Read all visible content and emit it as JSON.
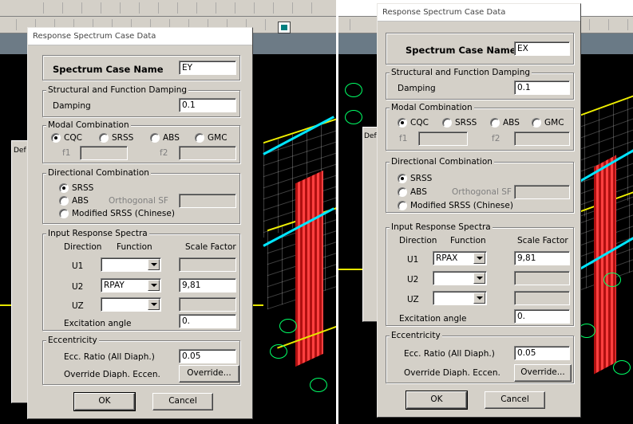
{
  "left": {
    "title": "Response Spectrum Case Data",
    "spectrum_case_name_label": "Spectrum Case Name",
    "spectrum_case_name": "EY",
    "damping_group_label": "Structural and Function Damping",
    "damping_label": "Damping",
    "damping_value": "0.1",
    "modal_group_label": "Modal Combination",
    "modal_options": [
      "CQC",
      "SRSS",
      "ABS",
      "GMC"
    ],
    "modal_selected": "CQC",
    "f1_label": "f1",
    "f2_label": "f2",
    "directional_group_label": "Directional Combination",
    "dir_srss": "SRSS",
    "dir_abs": "ABS",
    "orthogonal_sf_label": "Orthogonal SF",
    "dir_modified": "Modified SRSS (Chinese)",
    "dir_selected": "SRSS",
    "input_group_label": "Input Response Spectra",
    "col_direction": "Direction",
    "col_function": "Function",
    "col_scale": "Scale Factor",
    "rows": [
      {
        "dir": "U1",
        "func": "",
        "scale": ""
      },
      {
        "dir": "U2",
        "func": "RPAY",
        "scale": "9,81"
      },
      {
        "dir": "UZ",
        "func": "",
        "scale": ""
      }
    ],
    "excitation_label": "Excitation angle",
    "excitation_value": "0.",
    "ecc_group_label": "Eccentricity",
    "ecc_ratio_label": "Ecc. Ratio (All Diaph.)",
    "ecc_ratio_value": "0.05",
    "override_label": "Override Diaph. Eccen.",
    "override_button": "Override...",
    "ok_button": "OK",
    "cancel_button": "Cancel",
    "bg_dialog_label": "Def"
  },
  "right": {
    "title": "Response Spectrum Case Data",
    "spectrum_case_name_label": "Spectrum Case Name",
    "spectrum_case_name": "EX",
    "damping_group_label": "Structural and Function Damping",
    "damping_label": "Damping",
    "damping_value": "0.1",
    "modal_group_label": "Modal Combination",
    "modal_options": [
      "CQC",
      "SRSS",
      "ABS",
      "GMC"
    ],
    "modal_selected": "CQC",
    "f1_label": "f1",
    "f2_label": "f2",
    "directional_group_label": "Directional Combination",
    "dir_srss": "SRSS",
    "dir_abs": "ABS",
    "orthogonal_sf_label": "Orthogonal SF",
    "dir_modified": "Modified SRSS (Chinese)",
    "dir_selected": "SRSS",
    "input_group_label": "Input Response Spectra",
    "col_direction": "Direction",
    "col_function": "Function",
    "col_scale": "Scale Factor",
    "rows": [
      {
        "dir": "U1",
        "func": "RPAX",
        "scale": "9,81"
      },
      {
        "dir": "U2",
        "func": "",
        "scale": ""
      },
      {
        "dir": "UZ",
        "func": "",
        "scale": ""
      }
    ],
    "excitation_label": "Excitation angle",
    "excitation_value": "0.",
    "ecc_group_label": "Eccentricity",
    "ecc_ratio_label": "Ecc. Ratio (All Diaph.)",
    "ecc_ratio_value": "0.05",
    "override_label": "Override Diaph. Eccen.",
    "override_button": "Override...",
    "ok_button": "OK",
    "cancel_button": "Cancel",
    "bg_dialog_label": "Def"
  },
  "colors": {
    "dialog_face": "#d4d0c8",
    "model_red": "#b01010",
    "model_cyan": "#00e5ff",
    "model_yellow": "#e6e600"
  }
}
